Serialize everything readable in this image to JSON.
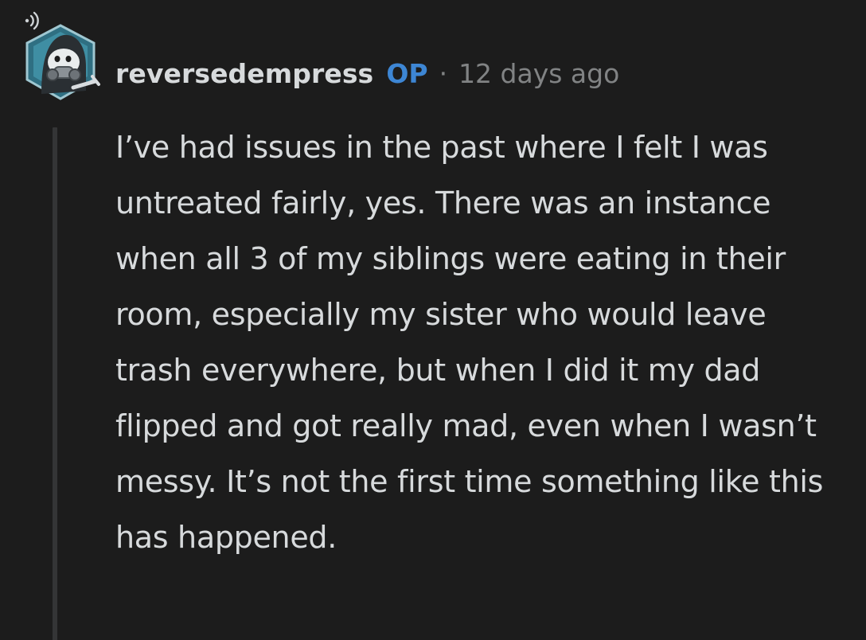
{
  "comment": {
    "author": "reversedempress",
    "op_badge": "OP",
    "separator": "·",
    "timestamp": "12 days ago",
    "body": "I’ve had issues in the past where I felt I was untreated fairly, yes. There was an instance when all 3 of my siblings were eating in their room, especially my sister who would leave trash everywhere, but when I did it my dad flipped and got really mad, even when I wasn’t messy. It’s not the first time something like this has happened."
  },
  "icons": {
    "avatar": "user-avatar-snoo-icon",
    "broadcast": "online-broadcast-icon"
  },
  "colors": {
    "background": "#1c1c1c",
    "text": "#d7dadc",
    "muted": "#818384",
    "op_accent": "#3d86d4",
    "thread_line": "#343536"
  }
}
